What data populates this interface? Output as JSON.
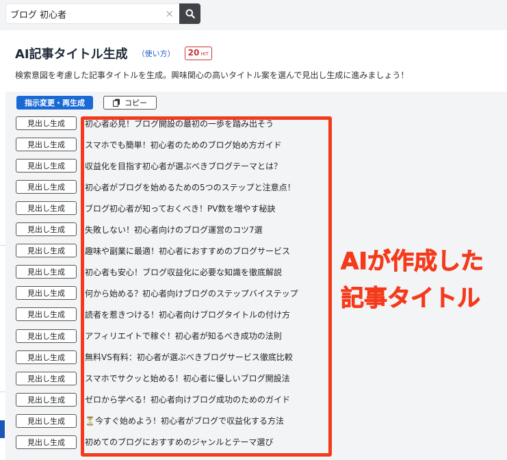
{
  "search": {
    "value": "ブログ 初心者",
    "clear_symbol": "×"
  },
  "header": {
    "title": "AI記事タイトル生成",
    "help_link": "（使い方）",
    "hit_count": "20",
    "hit_unit": "HIT",
    "description": "検索意図を考慮した記事タイトルを生成。興味関心の高いタイトル案を選んで見出し生成に進みましょう！"
  },
  "toolbar": {
    "regenerate_label": "指示変更・再生成",
    "copy_label": "コピー"
  },
  "row_button_label": "見出し生成",
  "titles": [
    "初心者必見！ブログ開設の最初の一歩を踏み出そう",
    "スマホでも簡単！初心者のためのブログ始め方ガイド",
    "収益化を目指す初心者が選ぶべきブログテーマとは？",
    "初心者がブログを始めるための5つのステップと注意点！",
    "ブログ初心者が知っておくべき！PV数を増やす秘訣",
    "失敗しない！初心者向けのブログ運営のコツ7選",
    "趣味や副業に最適！初心者におすすめのブログサービス",
    "初心者も安心！ブログ収益化に必要な知識を徹底解説",
    "何から始める？初心者向けブログのステップバイステップ",
    "読者を惹きつける！初心者向けブログタイトルの付け方",
    "アフィリエイトで稼ぐ！初心者が知るべき成功の法則",
    "無料VS有料：初心者が選ぶべきブログサービス徹底比較",
    "スマホでサクッと始める！初心者に優しいブログ開設法",
    "ゼロから学べる！初心者向けブログ成功のためのガイド",
    "⏳今すぐ始めよう！初心者がブログで収益化する方法",
    "初めてのブログにおすすめのジャンルとテーマ選び"
  ],
  "annotation": {
    "line1": "AIが作成した",
    "line2": "記事タイトル",
    "color": "#f53a1c"
  },
  "colors": {
    "primary_button": "#1a6ad6",
    "badge": "#d32f2f",
    "link": "#1a5cc8"
  }
}
